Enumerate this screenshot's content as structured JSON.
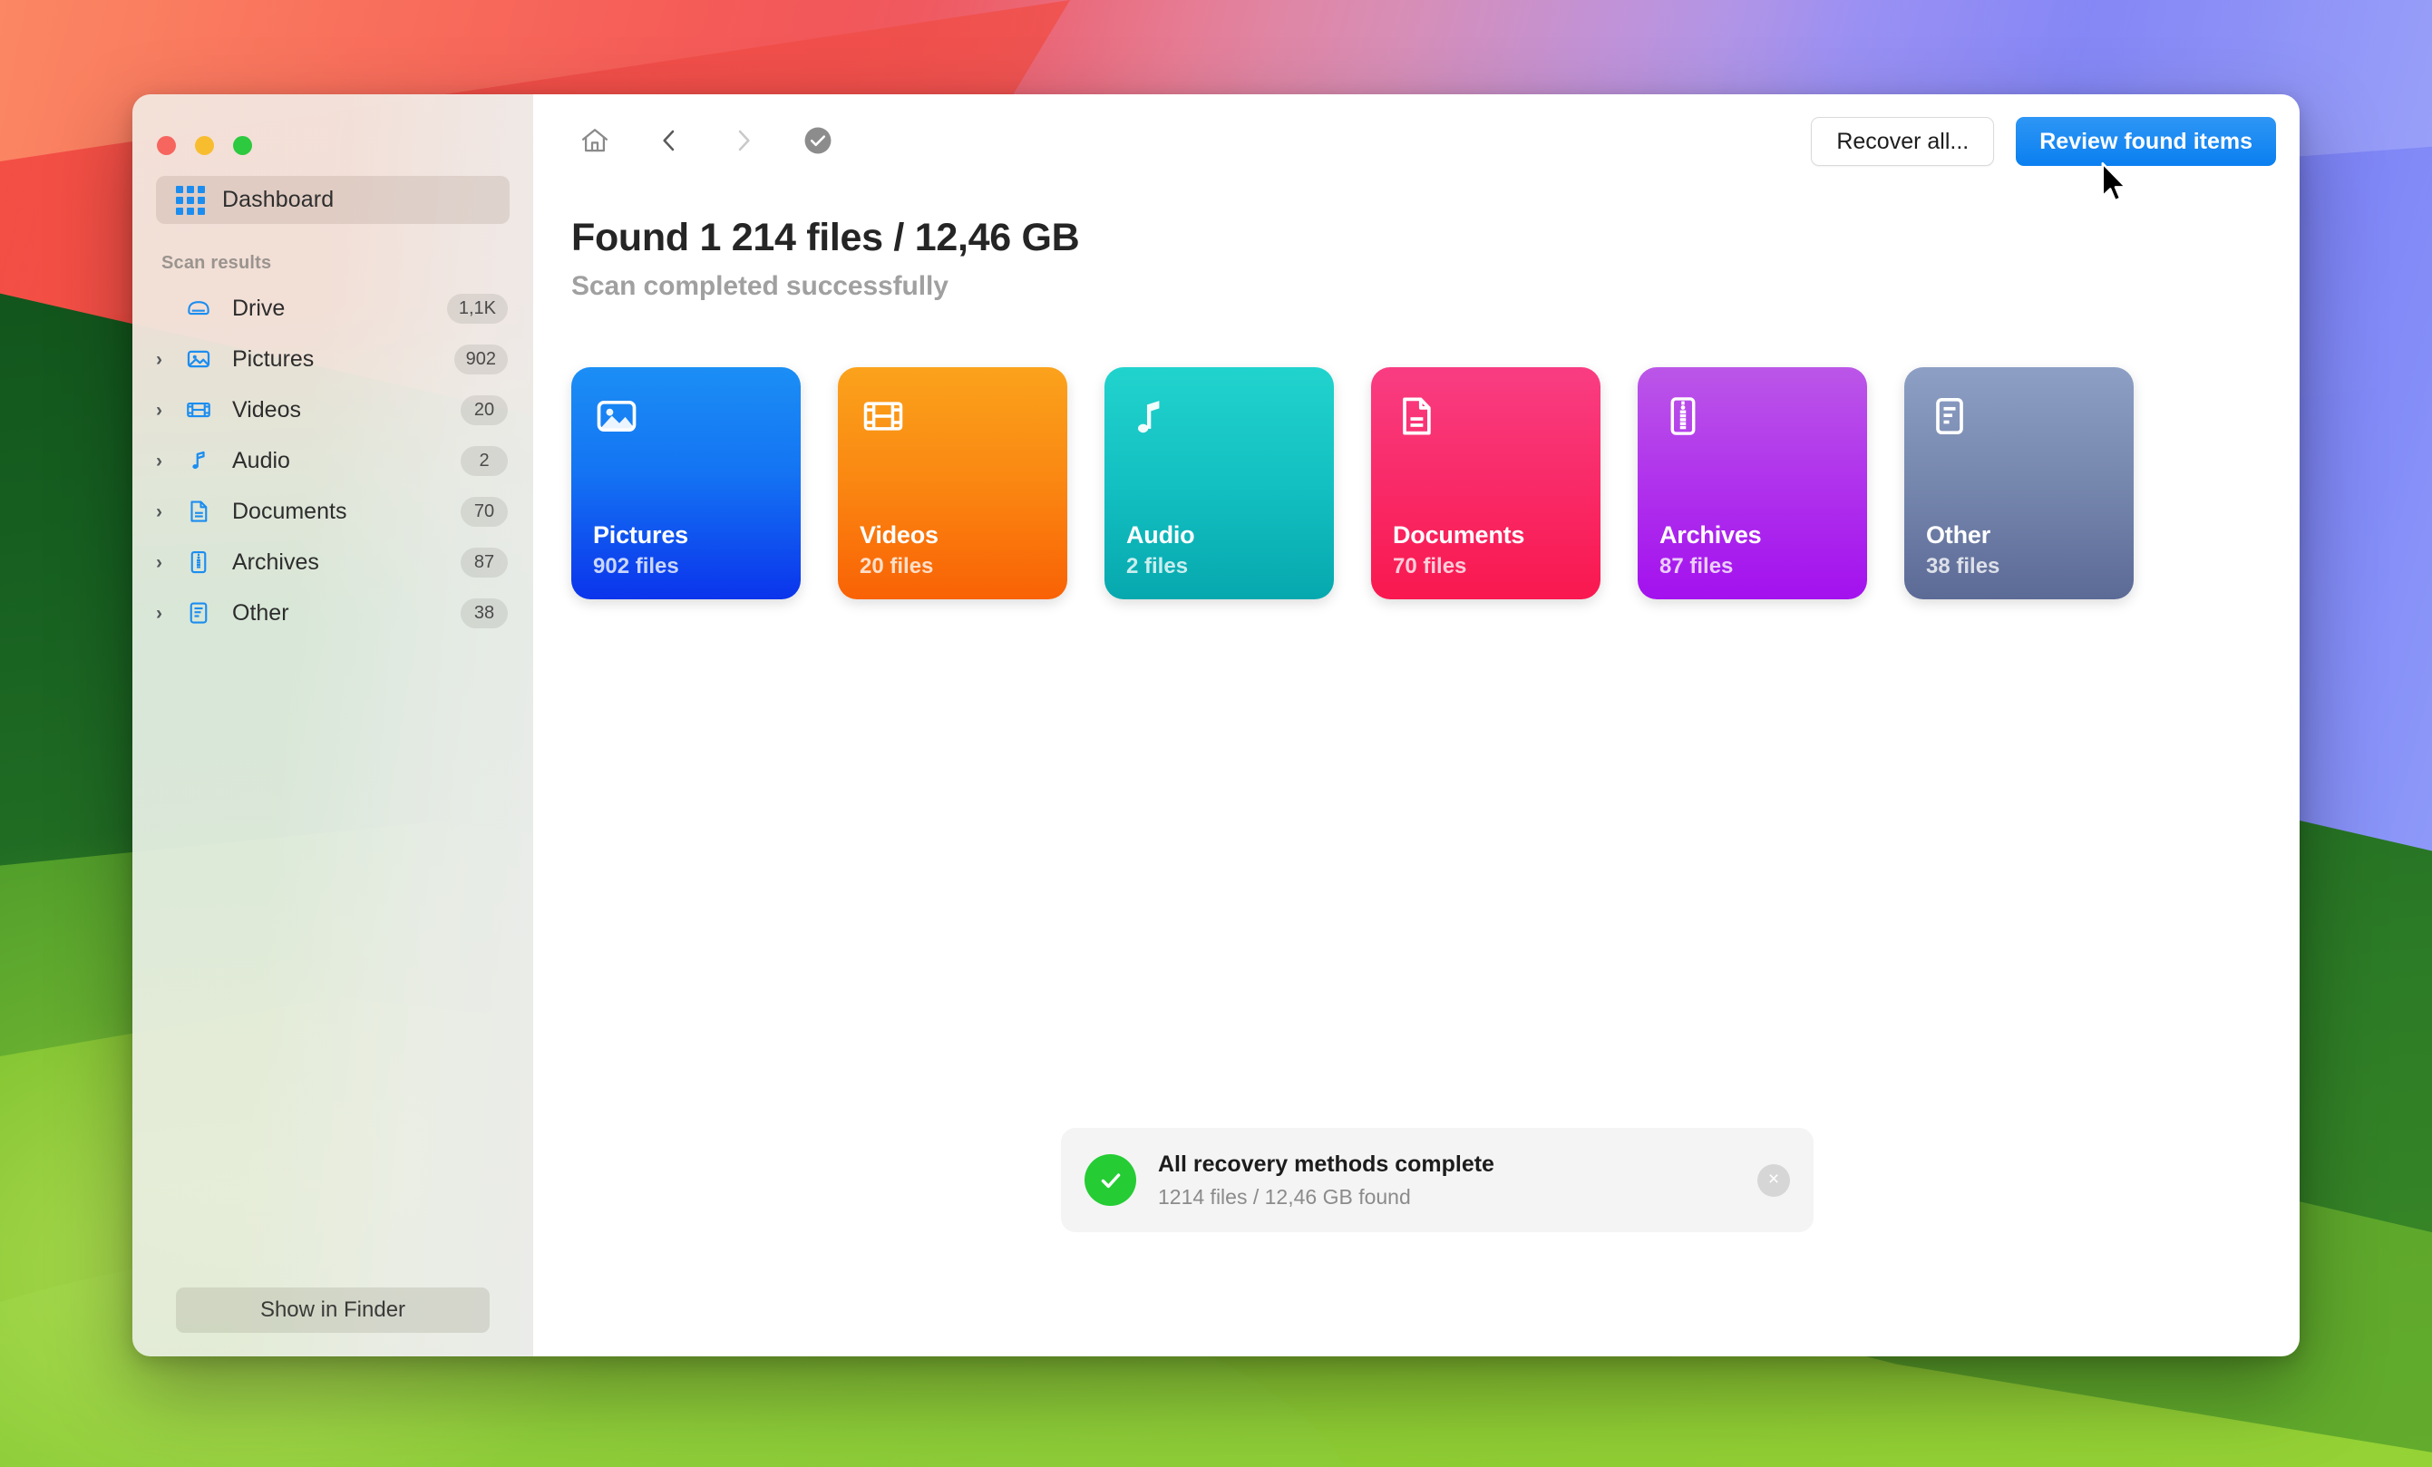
{
  "window": {
    "traffic_lights": [
      {
        "name": "close",
        "color": "#f6655e"
      },
      {
        "name": "minimize",
        "color": "#f8bd2f"
      },
      {
        "name": "zoom",
        "color": "#2dc93f"
      }
    ]
  },
  "sidebar": {
    "dashboard": {
      "label": "Dashboard",
      "icon": "grid-icon",
      "selected": true
    },
    "section_title": "Scan results",
    "items": [
      {
        "label": "Drive",
        "badge": "1,1K",
        "icon": "drive-icon",
        "expandable": false
      },
      {
        "label": "Pictures",
        "badge": "902",
        "icon": "picture-icon",
        "expandable": true
      },
      {
        "label": "Videos",
        "badge": "20",
        "icon": "film-icon",
        "expandable": true
      },
      {
        "label": "Audio",
        "badge": "2",
        "icon": "music-note-icon",
        "expandable": true
      },
      {
        "label": "Documents",
        "badge": "70",
        "icon": "document-icon",
        "expandable": true
      },
      {
        "label": "Archives",
        "badge": "87",
        "icon": "archive-icon",
        "expandable": true
      },
      {
        "label": "Other",
        "badge": "38",
        "icon": "list-icon",
        "expandable": true
      }
    ],
    "footer_button": "Show in Finder"
  },
  "toolbar": {
    "home_icon": "home-icon",
    "back_icon": "chevron-left-icon",
    "forward_icon": "chevron-right-icon",
    "status_icon": "check-circle-icon",
    "recover_all_label": "Recover all...",
    "review_label": "Review found items",
    "primary_color": "#0a7ff0"
  },
  "main": {
    "headline": "Found 1 214 files / 12,46 GB",
    "subhead": "Scan completed successfully",
    "tiles": [
      {
        "title": "Pictures",
        "count": "902 files",
        "icon": "picture-icon",
        "from": "#1b8ef5",
        "to": "#0b34ec"
      },
      {
        "title": "Videos",
        "count": "20 files",
        "icon": "film-icon",
        "from": "#fba21c",
        "to": "#f96205"
      },
      {
        "title": "Audio",
        "count": "2 files",
        "icon": "music-note-icon",
        "from": "#21d3cd",
        "to": "#06a8ae"
      },
      {
        "title": "Documents",
        "count": "70 files",
        "icon": "document-icon",
        "from": "#f93d82",
        "to": "#f9184f"
      },
      {
        "title": "Archives",
        "count": "87 files",
        "icon": "archive-icon",
        "from": "#bb56e8",
        "to": "#a311ee"
      },
      {
        "title": "Other",
        "count": "38 files",
        "icon": "list-icon",
        "from": "#8d9fc4",
        "to": "#5c6a96"
      }
    ]
  },
  "toast": {
    "icon": "check-circle-icon",
    "title": "All recovery methods complete",
    "subtitle": "1214 files / 12,46 GB found",
    "close_label": "×",
    "accent": "#25cc34"
  },
  "cursor": {
    "icon": "arrow-cursor"
  }
}
